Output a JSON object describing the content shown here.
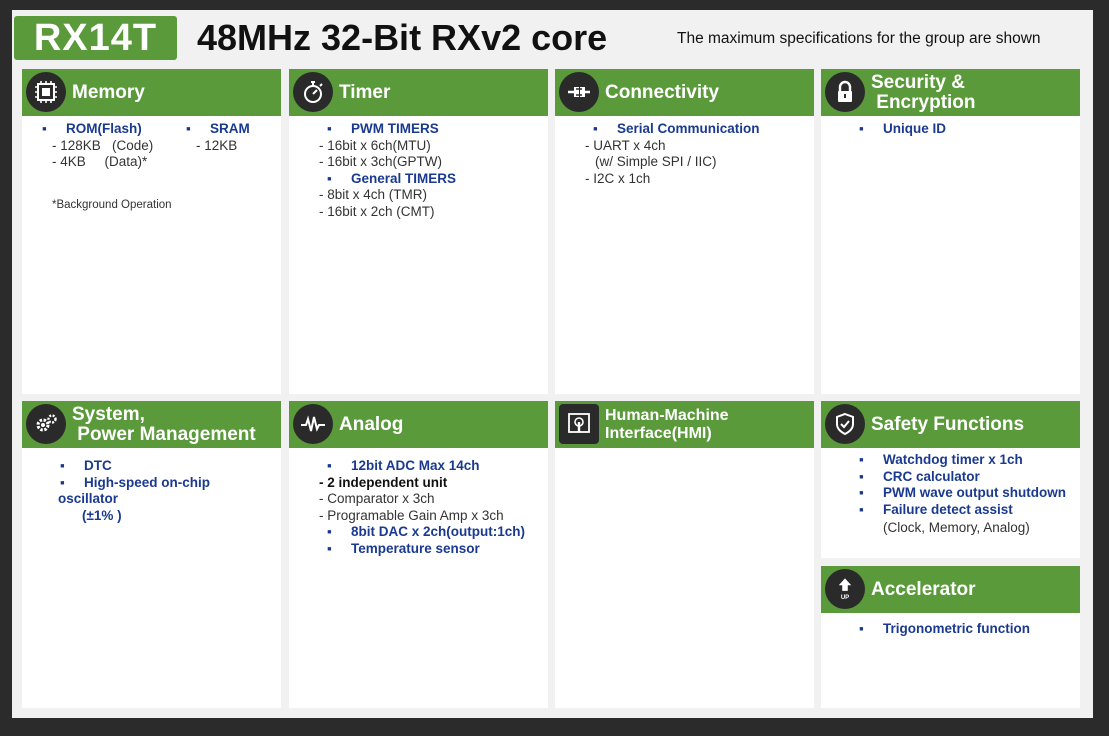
{
  "header": {
    "chip": "RX14T",
    "headline": "48MHz 32-Bit RXv2 core",
    "note": "The maximum specifications for the group are shown"
  },
  "colors": {
    "accent": "#5a9a3a",
    "bullet_text": "#1a3a8f",
    "icon_bg": "#2a2a2a"
  },
  "cards": {
    "memory": {
      "title": "Memory",
      "icon": "memory-chip-icon",
      "rom": "ROM(Flash)",
      "rom_code": "- 128KB   (Code)",
      "rom_data": "- 4KB     (Data)*",
      "sram": "SRAM",
      "sram_size": "- 12KB",
      "footnote": "*Background Operation"
    },
    "timer": {
      "title": "Timer",
      "icon": "stopwatch-icon",
      "pwm": "PWM TIMERS",
      "pwm_1": "- 16bit x 6ch(MTU)",
      "pwm_2": "- 16bit x 3ch(GPTW)",
      "general": "General TIMERS",
      "gen_1": "- 8bit x 4ch (TMR)",
      "gen_2": "- 16bit x 2ch (CMT)"
    },
    "connectivity": {
      "title": "Connectivity",
      "icon": "plug-icon",
      "serial": "Serial Communication",
      "uart": "- UART x 4ch",
      "uart_note": "(w/ Simple SPI / IIC)",
      "i2c": "- I2C x 1ch"
    },
    "security": {
      "title_1": "Security &",
      "title_2": "Encryption",
      "icon": "lock-icon",
      "uid": "Unique ID"
    },
    "system": {
      "title_1": "System,",
      "title_2": "Power Management",
      "icon": "gears-icon",
      "dtc": "DTC",
      "osc": "High-speed on-chip oscillator",
      "osc_acc": "(±1% )"
    },
    "analog": {
      "title": "Analog",
      "icon": "waveform-icon",
      "adc": "12bit  ADC Max 14ch",
      "adc_1": "- 2 independent unit",
      "adc_2": "- Comparator x 3ch",
      "adc_3": "- Programable Gain Amp x 3ch",
      "dac": "8bit DAC x 2ch(output:1ch)",
      "temp": "Temperature sensor"
    },
    "hmi": {
      "title_1": "Human-Machine",
      "title_2": "Interface(HMI)",
      "icon": "touch-screen-icon"
    },
    "safety": {
      "title": "Safety Functions",
      "icon": "shield-icon",
      "wdt": "Watchdog timer x 1ch",
      "crc": "CRC calculator",
      "pwm_shut": "PWM wave output shutdown",
      "fail": "Failure detect assist",
      "fail_note": "(Clock, Memory, Analog)"
    },
    "accelerator": {
      "title": "Accelerator",
      "icon": "up-arrow-icon",
      "icon_caption": "UP",
      "trig": "Trigonometric function"
    }
  }
}
